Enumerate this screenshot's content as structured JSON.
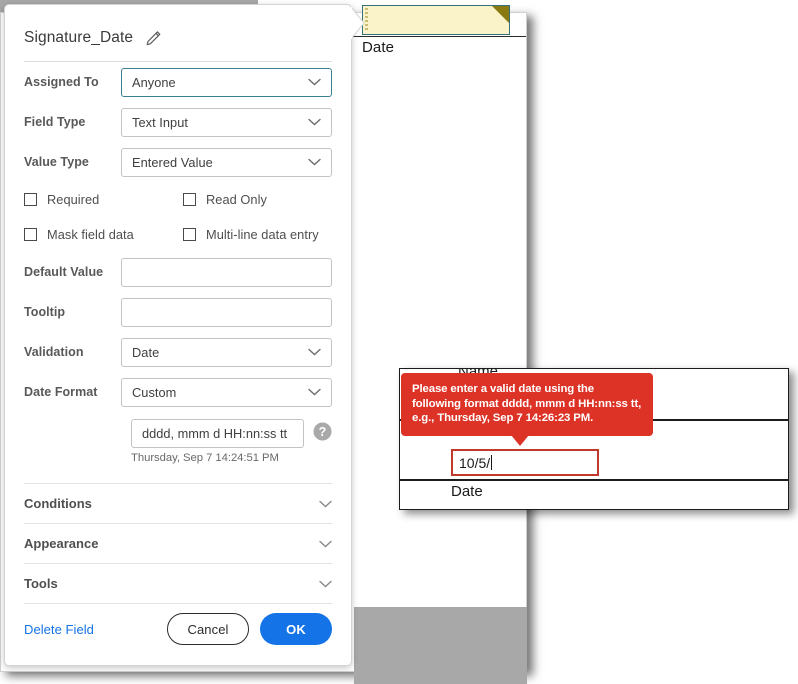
{
  "dialog": {
    "title": "Signature_Date",
    "edit_icon": "pencil-icon",
    "fields": [
      {
        "label": "Assigned To",
        "value": "Anyone",
        "control": "select",
        "focused": true
      },
      {
        "label": "Field Type",
        "value": "Text Input",
        "control": "select",
        "focused": false
      },
      {
        "label": "Value Type",
        "value": "Entered Value",
        "control": "select",
        "focused": false
      }
    ],
    "checkboxes": [
      {
        "label": "Required",
        "checked": false
      },
      {
        "label": "Read Only",
        "checked": false
      },
      {
        "label": "Mask field data",
        "checked": false
      },
      {
        "label": "Multi-line data entry",
        "checked": false
      }
    ],
    "default_value": {
      "label": "Default Value",
      "value": "",
      "placeholder": ""
    },
    "tooltip_field": {
      "label": "Tooltip",
      "value": "",
      "placeholder": ""
    },
    "validation": {
      "label": "Validation",
      "value": "Date"
    },
    "date_format": {
      "label": "Date Format",
      "value": "Custom"
    },
    "custom_format": {
      "value": "dddd, mmm d  HH:nn:ss tt",
      "preview": "Thursday, Sep 7 14:24:51 PM",
      "help_icon": "help-circle-icon"
    },
    "accordions": [
      {
        "label": "Conditions",
        "icon": "chevron-down-icon"
      },
      {
        "label": "Appearance",
        "icon": "chevron-down-icon"
      },
      {
        "label": "Tools",
        "icon": "chevron-down-icon"
      }
    ],
    "footer": {
      "delete_label": "Delete Field",
      "cancel_label": "Cancel",
      "ok_label": "OK"
    }
  },
  "document": {
    "yellow_field": {
      "label": "Date",
      "value": "",
      "corner_marker": "comment-corner-triangle"
    }
  },
  "preview": {
    "partial_label": "Name",
    "input_value": "10/5/",
    "date_label": "Date"
  },
  "error_tooltip": {
    "message": "Please enter a valid date using the following format dddd, mmm d HH:nn:ss tt, e.g., Thursday, Sep 7 14:26:23 PM."
  },
  "colors": {
    "accent_blue": "#1473e6",
    "error_red": "#dd3226",
    "field_yellow": "#faf2c8",
    "field_border_teal": "#36707a",
    "focus_border": "#3b7f92",
    "gray_backdrop": "#a8a8a8"
  }
}
